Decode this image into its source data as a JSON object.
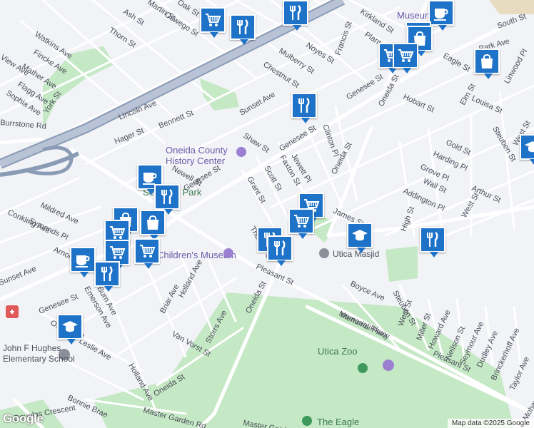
{
  "map": {
    "streets": [
      "Ash St",
      "Martin St",
      "Oak St",
      "Oswego St",
      "Thorn St",
      "Watkins Ave",
      "Fincke Ave",
      "Mather Ave",
      "Flagg Ave",
      "Sophia Ave",
      "View Ave",
      "York St",
      "Burrstone Rd",
      "Lincoln Ave",
      "Hager St",
      "Bennett St",
      "Sunset Ave",
      "Mulberry St",
      "Noyes St",
      "Chestnut St",
      "Francis St",
      "Kirkland St",
      "Plant St",
      "Park Ave",
      "South St",
      "Eagle St",
      "Linwood Pl",
      "Hobart St",
      "Elm St",
      "Louisa St",
      "Genesee St",
      "Shaw St",
      "Jewett Pl",
      "Clinton Pl",
      "Faxton St",
      "Scott St",
      "Grant St",
      "Newell St",
      "Oneida St",
      "Steuben St",
      "Gold St",
      "Harding Pl",
      "Grove Pl",
      "Wall St",
      "Arthur St",
      "Addington Pl",
      "West St",
      "High St",
      "James St",
      "Mildred Ave",
      "Symonds Pl",
      "Arnold Ave",
      "Sunset Ave",
      "Emerson Ave",
      "Oxford Rd",
      "Leslie Ave",
      "Briar Ave",
      "Holland Ave",
      "Storrs Ave",
      "Van Vorst St",
      "Thomas St",
      "Pleasant St",
      "Boyce Ave",
      "Memorial Pkwy",
      "Steuben St",
      "West St",
      "Miller St",
      "Howard Ave",
      "Neilson St",
      "Seymour Ave",
      "Dudley Ave",
      "Brinckerhoff Ave",
      "Taylor Ave",
      "Bonnie Brae",
      "Master Garden Rd",
      "Genesee St",
      "Oneida St",
      "Genesee St",
      "Oneida St",
      "Oneida St",
      "Genesee St",
      "Pleasant St",
      "Memorial Pkwy",
      "Douglas Crescent",
      "Master Garden Rd",
      "Burn Ave",
      "Conkling Ave",
      "Holland Ave",
      "West St",
      "Mohawk St"
    ],
    "places": {
      "history_center_l1": "Oneida County",
      "history_center_l2": "History Center",
      "seymour_park": "Seymour Park",
      "childrens_museum": "Children's Museum",
      "utica_masjid": "Utica Masjid",
      "utica_zoo": "Utica Zoo",
      "the_eagle": "The Eagle",
      "school_l1": "John F Hughes",
      "school_l2": "Elementary School",
      "top_poi": "Museum"
    },
    "attribution": "Map data ©2025 Google",
    "logo": "Google",
    "markers": [
      {
        "kind": "grocery-icon"
      },
      {
        "kind": "restaurant-icon"
      },
      {
        "kind": "restaurant-icon"
      },
      {
        "kind": "cafe-icon"
      },
      {
        "kind": "shopping-icon"
      },
      {
        "kind": "shopping-icon"
      },
      {
        "kind": "grocery-icon"
      },
      {
        "kind": "grocery-icon"
      },
      {
        "kind": "shopping-icon"
      },
      {
        "kind": "restaurant-icon"
      },
      {
        "kind": "cafe-icon"
      },
      {
        "kind": "restaurant-icon"
      },
      {
        "kind": "grocery-icon"
      },
      {
        "kind": "grocery-icon"
      },
      {
        "kind": "school-icon"
      },
      {
        "kind": "restaurant-icon"
      },
      {
        "kind": "restaurant-icon"
      },
      {
        "kind": "restaurant-icon"
      },
      {
        "kind": "shopping-icon"
      },
      {
        "kind": "shopping-icon"
      },
      {
        "kind": "grocery-icon"
      },
      {
        "kind": "grocery-icon"
      },
      {
        "kind": "grocery-icon"
      },
      {
        "kind": "cafe-icon"
      },
      {
        "kind": "restaurant-icon"
      },
      {
        "kind": "school-icon"
      },
      {
        "kind": "school-icon"
      }
    ],
    "colors": {
      "marker": "#1e73c8",
      "park": "#c5e8c5",
      "highway": "#8a9bb5",
      "road": "#ffffff",
      "background": "#f2f3f7"
    }
  }
}
